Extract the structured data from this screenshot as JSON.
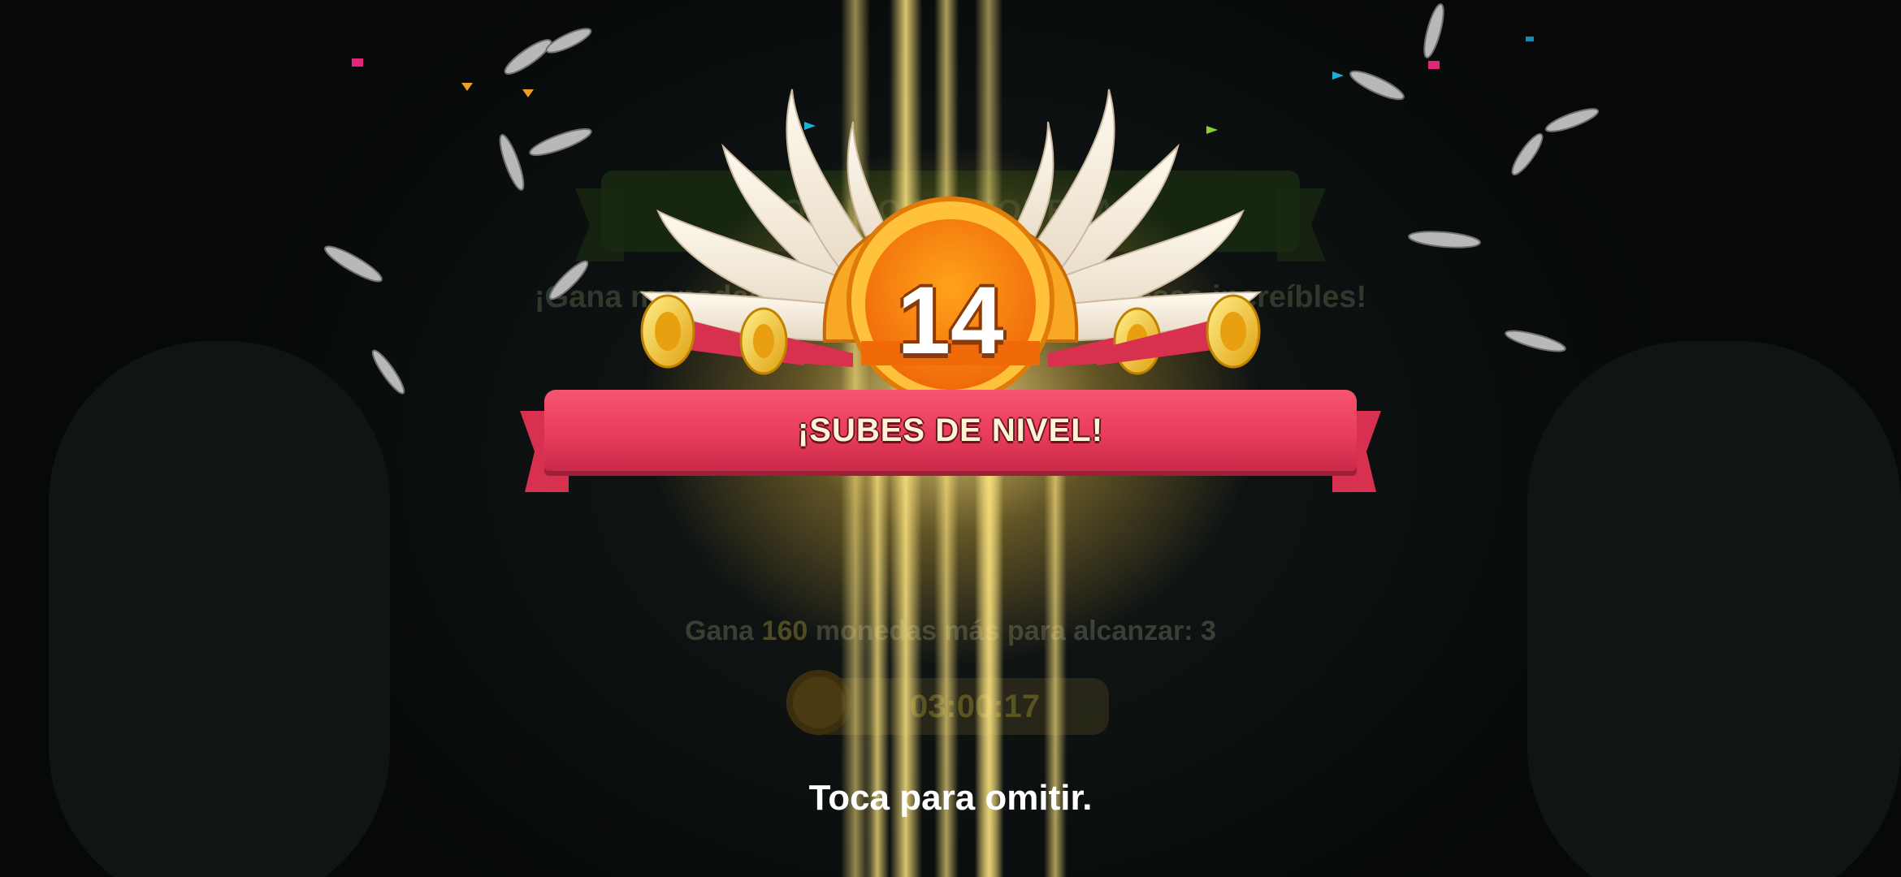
{
  "background": {
    "banner_title": "TORNEO DE MONEDAS",
    "subtitle": "¡Gana monedas para conseguir recompensas increíbles!",
    "goal_prefix": "Gana",
    "goal_amount": "160",
    "goal_suffix": "monedas más para alcanzar: 3",
    "timer": "03:00:17"
  },
  "level_up": {
    "level": "14",
    "title": "¡SUBES DE NIVEL!"
  },
  "skip_hint": "Toca para omitir.",
  "colors": {
    "ribbon": "#ea3c5b",
    "medal": "#f58a12",
    "beam": "#ffe680"
  },
  "icons": [
    "feather-icon",
    "wing-icon",
    "trumpet-icon",
    "clock-icon",
    "confetti-icon"
  ]
}
